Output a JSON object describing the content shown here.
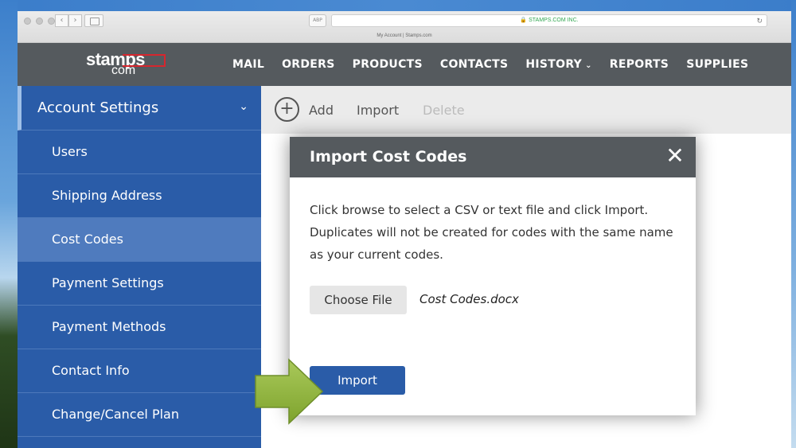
{
  "browser": {
    "url": "STAMPS.COM INC.",
    "tab_title": "My Account | Stamps.com",
    "ext_icon": "ABP"
  },
  "logo": {
    "line1": "stamps",
    "line2": "com"
  },
  "nav": {
    "items": [
      {
        "label": "MAIL"
      },
      {
        "label": "ORDERS"
      },
      {
        "label": "PRODUCTS"
      },
      {
        "label": "CONTACTS"
      },
      {
        "label": "HISTORY"
      },
      {
        "label": "REPORTS"
      },
      {
        "label": "SUPPLIES"
      }
    ]
  },
  "sidebar": {
    "header": "Account Settings",
    "items": [
      {
        "label": "Users"
      },
      {
        "label": "Shipping Address"
      },
      {
        "label": "Cost Codes"
      },
      {
        "label": "Payment Settings"
      },
      {
        "label": "Payment Methods"
      },
      {
        "label": "Contact Info"
      },
      {
        "label": "Change/Cancel Plan"
      }
    ],
    "active_index": 2
  },
  "toolbar": {
    "add_label": "Add",
    "import_label": "Import",
    "delete_label": "Delete"
  },
  "dialog": {
    "title": "Import Cost Codes",
    "instructions": "Click browse to select a CSV or text file and click Import. Duplicates will not be created for codes with the same name as your current codes.",
    "choose_file_label": "Choose File",
    "selected_file": "Cost Codes.docx",
    "import_label": "Import"
  },
  "colors": {
    "header_bg": "#555a5e",
    "sidebar_bg": "#2a5ca8",
    "sidebar_active": "#4f7bbe",
    "primary_button": "#2a5ca8",
    "arrow": "#8db33a"
  }
}
